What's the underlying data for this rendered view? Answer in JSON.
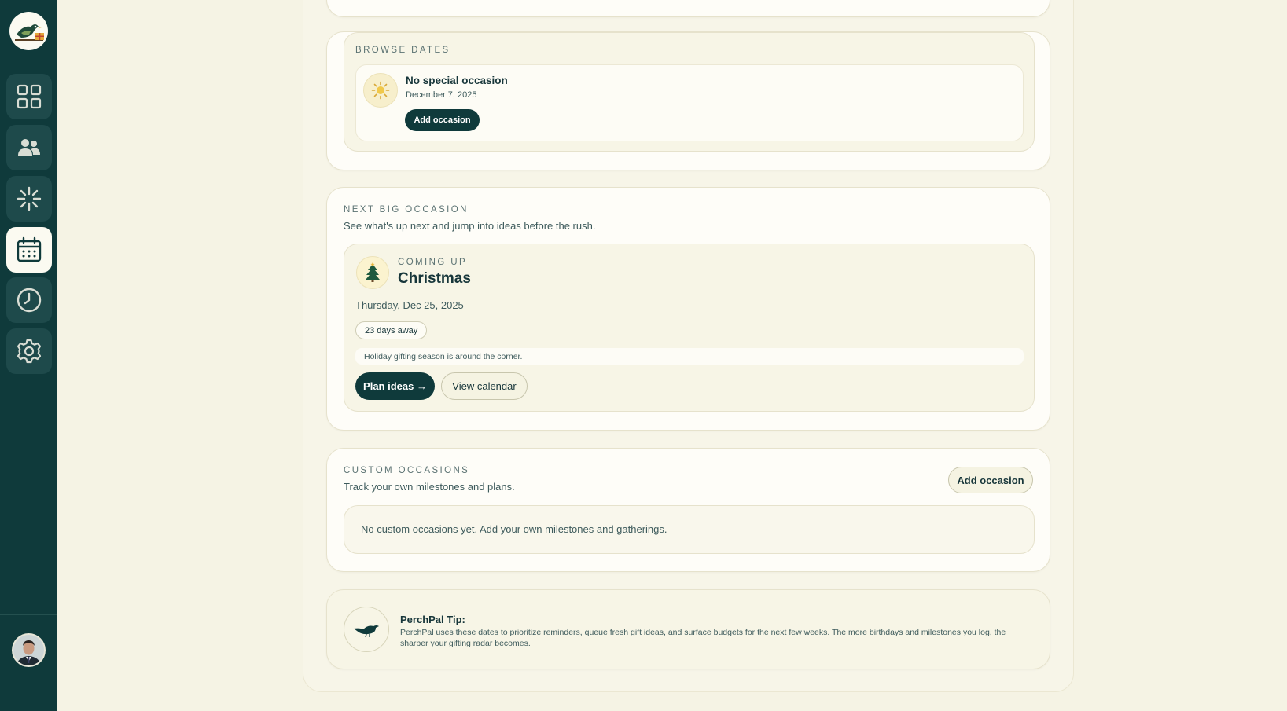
{
  "sidebar": {
    "logo_icon": "bird-with-gift-logo",
    "items": [
      {
        "name": "dashboard",
        "icon": "grid-icon",
        "active": false
      },
      {
        "name": "people",
        "icon": "users-icon",
        "active": false
      },
      {
        "name": "ideas",
        "icon": "sparkle-icon",
        "active": false
      },
      {
        "name": "calendar",
        "icon": "calendar-icon",
        "active": true
      },
      {
        "name": "history",
        "icon": "clock-icon",
        "active": false
      },
      {
        "name": "settings",
        "icon": "gear-icon",
        "active": false
      }
    ]
  },
  "browse_dates": {
    "eyebrow": "BROWSE DATES",
    "occasion_title": "No special occasion",
    "occasion_date": "December 7, 2025",
    "add_button": "Add occasion"
  },
  "next_big": {
    "eyebrow": "NEXT BIG OCCASION",
    "subtitle": "See what's up next and jump into ideas before the rush.",
    "coming_up": "COMING UP",
    "name": "Christmas",
    "date": "Thursday, Dec 25, 2025",
    "days_away": "23 days away",
    "note": "Holiday gifting season is around the corner.",
    "plan_button": "Plan ideas →",
    "calendar_button": "View calendar"
  },
  "custom": {
    "eyebrow": "CUSTOM OCCASIONS",
    "subtitle": "Track your own milestones and plans.",
    "add_button": "Add occasion",
    "empty": "No custom occasions yet. Add your own milestones and gatherings."
  },
  "tip": {
    "title": "PerchPal Tip:",
    "body": "PerchPal uses these dates to prioritize reminders, queue fresh gift ideas, and surface budgets for the next few weeks. The more birthdays and milestones you log, the sharper your gifting radar becomes."
  },
  "colors": {
    "sidebar": "#0f3a3b",
    "background": "#f5f3e4",
    "accent_dark": "#0f3a3b"
  }
}
